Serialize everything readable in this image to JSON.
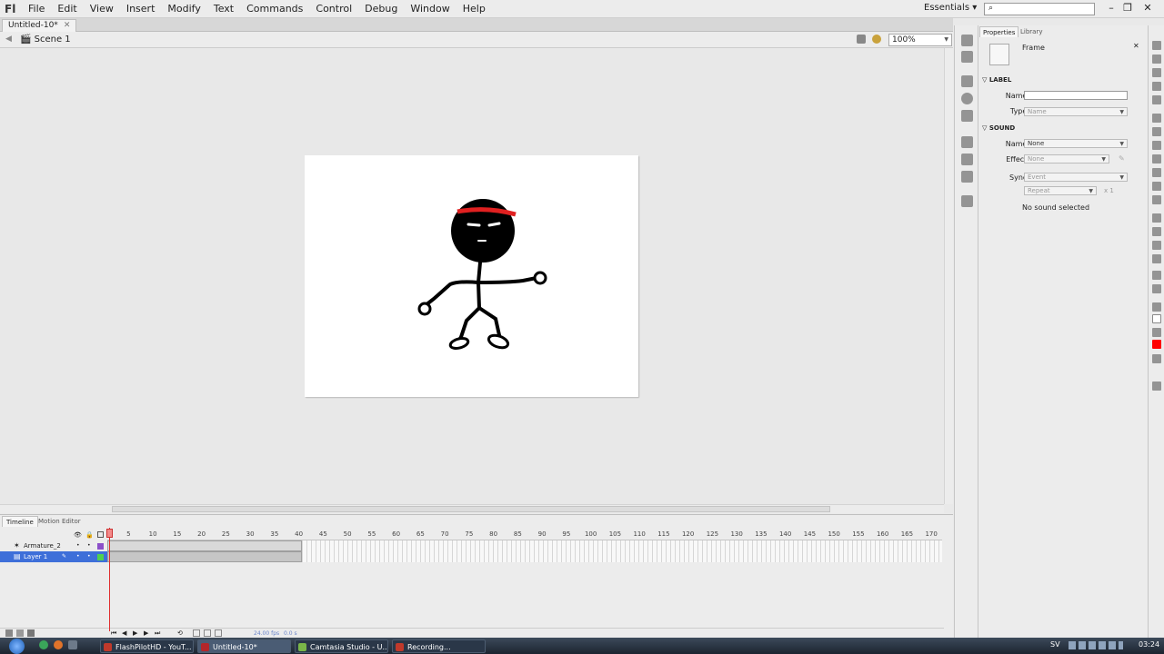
{
  "app": {
    "logo": "Fl",
    "menus": [
      "File",
      "Edit",
      "View",
      "Insert",
      "Modify",
      "Text",
      "Commands",
      "Control",
      "Debug",
      "Window",
      "Help"
    ],
    "workspace": "Essentials",
    "search_icon": "search-icon",
    "window_buttons": [
      "–",
      "❐",
      "✕"
    ]
  },
  "document": {
    "tab_title": "Untitled-10*",
    "tab_close": "✕",
    "scene": "Scene 1",
    "zoom": "100%"
  },
  "timeline": {
    "tabs": [
      "Timeline",
      "Motion Editor"
    ],
    "ruler": [
      "5",
      "10",
      "15",
      "20",
      "25",
      "30",
      "35",
      "40",
      "45",
      "50",
      "55",
      "60",
      "65",
      "70",
      "75",
      "80",
      "85",
      "90",
      "95",
      "100",
      "105",
      "110",
      "115",
      "120",
      "125",
      "130",
      "135",
      "140",
      "145",
      "150",
      "155",
      "160",
      "165",
      "170"
    ],
    "layers": [
      {
        "name": "Armature_2",
        "selected": false
      },
      {
        "name": "Layer 1",
        "selected": true
      }
    ],
    "current_frame": 1,
    "span_end_frame": 40,
    "fps": "24.00 fps",
    "elapsed": "0.0 s"
  },
  "properties": {
    "tabs": [
      "Properties",
      "Library"
    ],
    "type_label": "Frame",
    "label_section": "LABEL",
    "name_label": "Name:",
    "name_value": "",
    "type_field_label": "Type:",
    "type_value": "Name",
    "sound_section": "SOUND",
    "sound_name_label": "Name:",
    "sound_name_value": "None",
    "effect_label": "Effect:",
    "effect_value": "None",
    "sync_label": "Sync:",
    "sync_value": "Event",
    "repeat_value": "Repeat",
    "repeat_count": "x 1",
    "status": "No sound selected"
  },
  "taskbar": {
    "items": [
      {
        "label": "FlashPilotHD - YouT...",
        "active": false,
        "color": "#c0392b"
      },
      {
        "label": "Untitled-10*",
        "active": true,
        "color": "#b3262a"
      },
      {
        "label": "Camtasia Studio - U...",
        "active": false,
        "color": "#7ab648"
      },
      {
        "label": "Recording...",
        "active": false,
        "color": "#c0392b"
      }
    ],
    "lang": "SV",
    "clock": "03:24"
  },
  "colors": {
    "selection": "#3e6fd9",
    "playhead": "#e03030",
    "headband": "#e02020",
    "fill_swatch": "#ff0000"
  }
}
